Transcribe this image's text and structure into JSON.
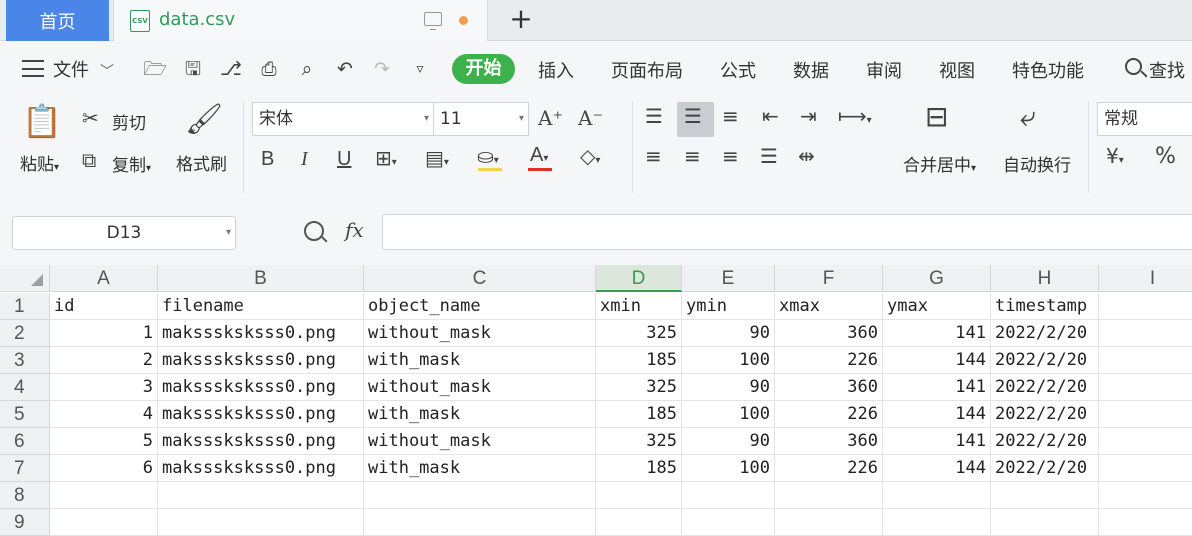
{
  "tabbar": {
    "home_tab": "首页",
    "file_tab": {
      "icon_text": "CSV",
      "name": "data.csv"
    },
    "new_tab": "+"
  },
  "menu": {
    "file_menu": "文件",
    "tabs": [
      "开始",
      "插入",
      "页面布局",
      "公式",
      "数据",
      "审阅",
      "视图",
      "特色功能"
    ],
    "active_tab": "开始",
    "search": "查找"
  },
  "toolbar": {
    "paste": "粘贴",
    "cut": "剪切",
    "copy": "复制",
    "format_painter": "格式刷",
    "font_name": "宋体",
    "font_size": "11",
    "merge_center": "合并居中",
    "wrap_text": "自动换行",
    "number_format": "常规",
    "bold": "B",
    "italic": "I",
    "underline": "U",
    "font_color_letter": "A",
    "percent": "%",
    "currency": "¥",
    "highlight_color": "#f3d34a",
    "font_color": "#e0302a"
  },
  "formula_bar": {
    "name_box": "D13",
    "fx": "fx",
    "formula": ""
  },
  "sheet": {
    "columns": [
      "A",
      "B",
      "C",
      "D",
      "E",
      "F",
      "G",
      "H",
      "I"
    ],
    "active_column": "D",
    "row_numbers": [
      "1",
      "2",
      "3",
      "4",
      "5",
      "6",
      "7",
      "8",
      "9"
    ],
    "header_row": [
      "id",
      "filename",
      "object_name",
      "xmin",
      "ymin",
      "xmax",
      "ymax",
      "timestamp"
    ],
    "rows": [
      [
        "1",
        "maksssksksss0.png",
        "without_mask",
        "325",
        "90",
        "360",
        "141",
        "2022/2/20"
      ],
      [
        "2",
        "maksssksksss0.png",
        "with_mask",
        "185",
        "100",
        "226",
        "144",
        "2022/2/20"
      ],
      [
        "3",
        "maksssksksss0.png",
        "without_mask",
        "325",
        "90",
        "360",
        "141",
        "2022/2/20"
      ],
      [
        "4",
        "maksssksksss0.png",
        "with_mask",
        "185",
        "100",
        "226",
        "144",
        "2022/2/20"
      ],
      [
        "5",
        "maksssksksss0.png",
        "without_mask",
        "325",
        "90",
        "360",
        "141",
        "2022/2/20"
      ],
      [
        "6",
        "maksssksksss0.png",
        "with_mask",
        "185",
        "100",
        "226",
        "144",
        "2022/2/20"
      ]
    ]
  }
}
